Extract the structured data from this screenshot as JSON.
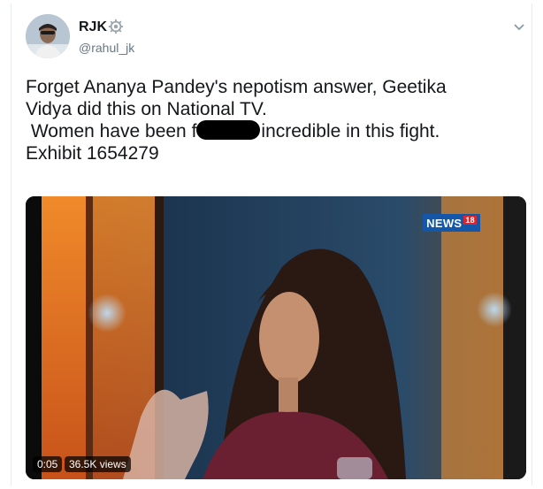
{
  "user": {
    "display_name": "RJK",
    "handle": "@rahul_jk",
    "badge_icon": "gear-icon",
    "avatar_icon": "avatar"
  },
  "menu": {
    "icon": "chevron-down-icon"
  },
  "tweet": {
    "line1": "Forget Ananya Pandey's nepotism answer, Geetika",
    "line2": "Vidya did this on National TV.",
    "line3_before": " Women have been f",
    "line3_after": "incredible in this fight.",
    "line4": "Exhibit 1654279"
  },
  "video": {
    "channel_logo": "NEWS",
    "channel_number": "18",
    "elapsed": "0:05",
    "views": "36.5K views"
  },
  "colors": {
    "text": "#14171a",
    "secondary": "#657786",
    "border": "#e6ecf0"
  }
}
